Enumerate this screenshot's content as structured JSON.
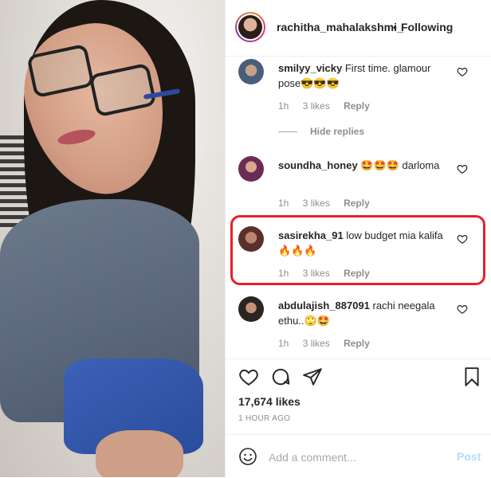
{
  "header": {
    "username": "rachitha_mahalakshmi_",
    "separator": "•",
    "follow_label": "Following"
  },
  "comments": [
    {
      "username": "smilyy_vicky",
      "text": "First time. glamour pose😎😎😎",
      "time": "1h",
      "likes": "3 likes",
      "reply": "Reply"
    },
    {
      "username": "soundha_honey",
      "text": "🤩🤩🤩 darloma",
      "time": "1h",
      "likes": "3 likes",
      "reply": "Reply"
    },
    {
      "username": "sasirekha_91",
      "text": "low budget mia kalifa 🔥🔥🔥",
      "time": "1h",
      "likes": "3 likes",
      "reply": "Reply"
    },
    {
      "username": "abdulajish_887091",
      "text": "rachi neegala ethu..🙄🤩",
      "time": "1h",
      "likes": "3 likes",
      "reply": "Reply"
    }
  ],
  "hide_replies": "Hide replies",
  "post": {
    "likes": "17,674 likes",
    "timestamp": "1 HOUR AGO"
  },
  "add_comment": {
    "placeholder": "Add a comment...",
    "post_label": "Post"
  },
  "colors": {
    "highlight": "#e8202a",
    "post_disabled": "#b3dbff",
    "meta": "#8e8e8e"
  }
}
